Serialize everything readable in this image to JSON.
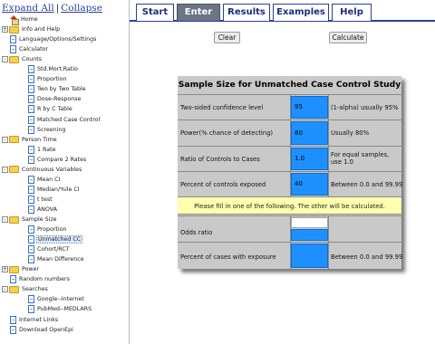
{
  "tree": {
    "expand_all": "Expand All",
    "separator": "|",
    "collapse": "Collapse",
    "items": [
      {
        "label": "Home",
        "icon": "home"
      },
      {
        "label": "Info and Help",
        "icon": "folder",
        "ctl": "+"
      },
      {
        "label": "Language/Options/Settings",
        "icon": "page"
      },
      {
        "label": "Calculator",
        "icon": "page"
      },
      {
        "label": "Counts",
        "icon": "folder",
        "ctl": "-"
      },
      {
        "label": "Std.Mort.Ratio",
        "icon": "page"
      },
      {
        "label": "Proportion",
        "icon": "page"
      },
      {
        "label": "Two by Two Table",
        "icon": "page"
      },
      {
        "label": "Dose-Response",
        "icon": "page"
      },
      {
        "label": "R by C Table",
        "icon": "page"
      },
      {
        "label": "Matched Case Control",
        "icon": "page"
      },
      {
        "label": "Screening",
        "icon": "page"
      },
      {
        "label": "Person Time",
        "icon": "folder",
        "ctl": "-"
      },
      {
        "label": "1 Rate",
        "icon": "page"
      },
      {
        "label": "Compare 2 Rates",
        "icon": "page"
      },
      {
        "label": "Continuous Variables",
        "icon": "folder",
        "ctl": "-"
      },
      {
        "label": "Mean CI",
        "icon": "page"
      },
      {
        "label": "Median/%ile CI",
        "icon": "page"
      },
      {
        "label": "t test",
        "icon": "page"
      },
      {
        "label": "ANOVA",
        "icon": "page"
      },
      {
        "label": "Sample Size",
        "icon": "folder",
        "ctl": "-"
      },
      {
        "label": "Proportion",
        "icon": "page"
      },
      {
        "label": "Unmatched CC",
        "icon": "page"
      },
      {
        "label": "Cohort/RCT",
        "icon": "page"
      },
      {
        "label": "Mean Difference",
        "icon": "page"
      },
      {
        "label": "Power",
        "icon": "folder",
        "ctl": "+"
      },
      {
        "label": "Random numbers",
        "icon": "page"
      },
      {
        "label": "Searches",
        "icon": "folder",
        "ctl": "-"
      },
      {
        "label": "Google--Internet",
        "icon": "page"
      },
      {
        "label": "PubMed--MEDLARS",
        "icon": "page"
      },
      {
        "label": "Internet Links",
        "icon": "page"
      },
      {
        "label": "Download OpenEpi",
        "icon": "page"
      }
    ]
  },
  "tabs": [
    "Start",
    "Enter",
    "Results",
    "Examples",
    "Help"
  ],
  "active_tab": "Enter",
  "buttons": {
    "clear": "Clear",
    "calculate": "Calculate"
  },
  "form": {
    "title": "Sample Size for Unmatched Case Control Study",
    "rows": [
      {
        "label": "Two-sided confidence level",
        "value": "95",
        "note": "(1-alpha) usually 95%"
      },
      {
        "label": "Power(% chance of detecting)",
        "value": "80",
        "note": "Usually 80%"
      },
      {
        "label": "Ratio of Controls to Cases",
        "value": "1.0",
        "note": "For equal samples, use 1.0"
      },
      {
        "label": "Percent of controls exposed",
        "value": "40",
        "note": "Between 0.0 and 99.99"
      }
    ],
    "instruction": "Please fill in one of the following.  The other will be calculated.",
    "odds_ratio_label": "Odds ratio",
    "odds_ratio_value": "",
    "pct_cases_label": "Percent of cases with exposure",
    "pct_cases_value": "",
    "pct_cases_note": "Between 0.0 and 99.99"
  },
  "colors": {
    "input_fill": "#1e90ff",
    "instruction_bg": "#ffffb0",
    "panel_bg": "#c9c9c9",
    "active_tab": "#6b7584"
  }
}
